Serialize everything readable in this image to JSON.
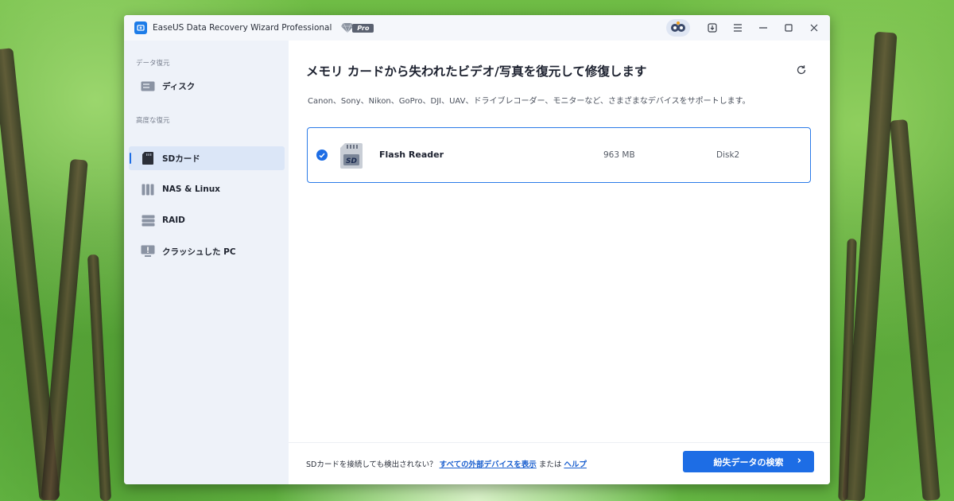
{
  "app": {
    "title": "EaseUS Data Recovery Wizard Professional",
    "badge": "Pro"
  },
  "titlebar": {
    "icons": [
      "user-avatar-icon",
      "download-icon",
      "menu-icon",
      "minimize-icon",
      "maximize-icon",
      "close-icon"
    ]
  },
  "sidebar": {
    "section1": "データ復元",
    "section2": "高度な復元",
    "items": [
      {
        "label": "ディスク",
        "icon": "disk-icon"
      },
      {
        "label": "SDカード",
        "icon": "sd-card-icon",
        "active": true
      },
      {
        "label": "NAS & Linux",
        "icon": "nas-icon"
      },
      {
        "label": "RAID",
        "icon": "raid-icon"
      },
      {
        "label": "クラッシュした PC",
        "icon": "crashed-pc-icon"
      }
    ]
  },
  "main": {
    "heading": "メモリ カードから失われたビデオ/写真を復元して修復します",
    "subheading": "Canon、Sony、Nikon、GoPro、DJI、UAV、ドライブレコーダー、モニターなど、さまざまなデバイスをサポートします。",
    "device": {
      "name": "Flash Reader",
      "size": "963 MB",
      "disk": "Disk2",
      "selected": true,
      "icon_text": "SD"
    }
  },
  "footer": {
    "prefix": "SDカードを接続しても検出されない？",
    "link_all": "すべての外部デバイスを表示",
    "or": "または",
    "link_help": "ヘルプ",
    "scan_button": "紛失データの検索"
  },
  "colors": {
    "accent": "#1d6de5",
    "sidebar_bg": "#eef2f9",
    "active_bg": "#dbe6f7"
  }
}
